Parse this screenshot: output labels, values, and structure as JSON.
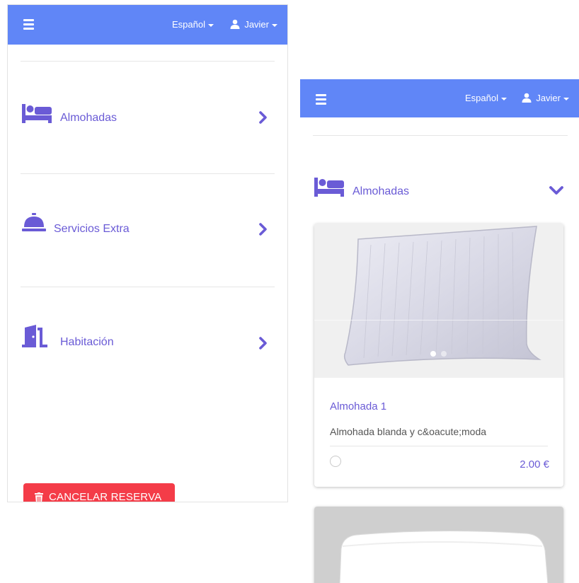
{
  "colors": {
    "navbar": "#6086f7",
    "accent": "#6a5bd6",
    "danger": "#f43c48"
  },
  "navbar": {
    "language": "Español",
    "user": "Javier",
    "menu_icon": "hamburger-icon",
    "user_icon": "user-icon"
  },
  "left": {
    "categories": [
      {
        "label": "Almohadas",
        "icon": "bed-icon",
        "state": "collapsed"
      },
      {
        "label": "Servicios Extra",
        "icon": "concierge-bell-icon",
        "state": "collapsed"
      },
      {
        "label": "Habitación",
        "icon": "door-open-icon",
        "state": "collapsed"
      }
    ],
    "cancel_button": "CANCELAR RESERVA"
  },
  "right": {
    "category": {
      "label": "Almohadas",
      "icon": "bed-icon",
      "state": "expanded"
    },
    "products": [
      {
        "title": "Almohada 1",
        "description": "Almohada blanda y c&oacute;moda",
        "price": "2.00 €",
        "carousel_slides": 2,
        "active_slide": 1
      }
    ]
  }
}
